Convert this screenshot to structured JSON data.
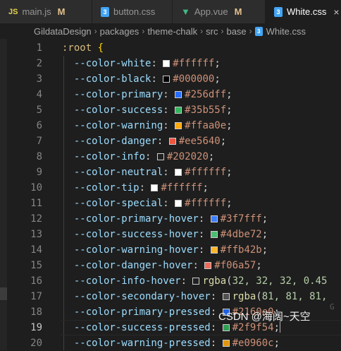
{
  "tabs": [
    {
      "icon": "JS",
      "label": "main.js",
      "modified": "M",
      "active": false
    },
    {
      "icon": "css",
      "label": "button.css",
      "modified": "",
      "active": false
    },
    {
      "icon": "vue",
      "label": "App.vue",
      "modified": "M",
      "active": false
    },
    {
      "icon": "css",
      "label": "White.css",
      "modified": "",
      "active": true,
      "close": "×"
    }
  ],
  "breadcrumb": [
    "GildataDesign",
    "packages",
    "theme-chalk",
    "src",
    "base",
    "White.css"
  ],
  "breadcrumb_sep": "›",
  "lines": [
    {
      "n": "1",
      "sel": ":root",
      "brace": "{"
    },
    {
      "n": "2",
      "prop": "--color-white",
      "color": "#ffffff",
      "value": "#ffffff"
    },
    {
      "n": "3",
      "prop": "--color-black",
      "color": "#000000",
      "value": "#000000"
    },
    {
      "n": "4",
      "prop": "--color-primary",
      "color": "#256dff",
      "value": "#256dff"
    },
    {
      "n": "5",
      "prop": "--color-success",
      "color": "#35b55f",
      "value": "#35b55f"
    },
    {
      "n": "6",
      "prop": "--color-warning",
      "color": "#ffaa0e",
      "value": "#ffaa0e"
    },
    {
      "n": "7",
      "prop": "--color-danger",
      "color": "#ee5640",
      "value": "#ee5640"
    },
    {
      "n": "8",
      "prop": "--color-info",
      "color": "#202020",
      "value": "#202020"
    },
    {
      "n": "9",
      "prop": "--color-neutral",
      "color": "#ffffff",
      "value": "#ffffff"
    },
    {
      "n": "10",
      "prop": "--color-tip",
      "color": "#ffffff",
      "value": "#ffffff"
    },
    {
      "n": "11",
      "prop": "--color-special",
      "color": "#ffffff",
      "value": "#ffffff"
    },
    {
      "n": "12",
      "prop": "--color-primary-hover",
      "color": "#3f7fff",
      "value": "#3f7fff"
    },
    {
      "n": "13",
      "prop": "--color-success-hover",
      "color": "#4dbe72",
      "value": "#4dbe72"
    },
    {
      "n": "14",
      "prop": "--color-warning-hover",
      "color": "#ffb42b",
      "value": "#ffb42b"
    },
    {
      "n": "15",
      "prop": "--color-danger-hover",
      "color": "#f06a57",
      "value": "#f06a57"
    },
    {
      "n": "16",
      "prop": "--color-info-hover",
      "color": "#202020",
      "fn": "rgba",
      "args": "32, 32, 32, 0.45"
    },
    {
      "n": "17",
      "prop": "--color-secondary-hover",
      "color": "#515151",
      "fn": "rgba",
      "args": "81, 81, 81,"
    },
    {
      "n": "18",
      "prop": "--color-primary-pressed",
      "color": "#2160e0",
      "value": "#2160e0"
    },
    {
      "n": "19",
      "prop": "--color-success-pressed",
      "color": "#2f9f54",
      "value": "#2f9f54",
      "current": true
    },
    {
      "n": "20",
      "prop": "--color-warning-pressed",
      "color": "#e0960c",
      "value": "#e0960c"
    }
  ],
  "watermark": "CSDN @海阔~天空",
  "blame_hint": "G"
}
